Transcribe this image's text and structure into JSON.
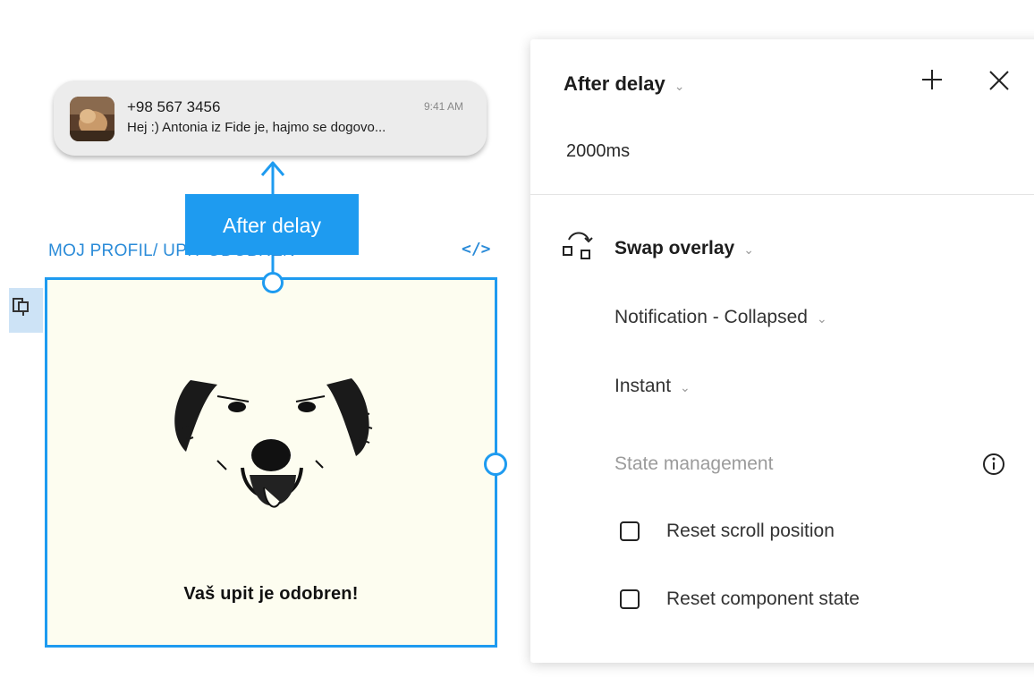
{
  "notification": {
    "phone": "+98 567 3456",
    "time": "9:41 AM",
    "message": "Hej :) Antonia iz Fide je, hajmo se dogovo..."
  },
  "connector": {
    "label": "After delay"
  },
  "frame": {
    "name": "MOJ PROFIL/ UPIT ODOBREN",
    "code_icon": "</>",
    "text": "Vaš upit je odobren!"
  },
  "panel": {
    "trigger": "After delay",
    "delay": "2000ms",
    "action": "Swap overlay",
    "destination": "Notification - Collapsed",
    "animation": "Instant",
    "state_management": "State management",
    "options": [
      {
        "label": "Reset scroll position",
        "checked": false
      },
      {
        "label": "Reset component state",
        "checked": false
      }
    ]
  },
  "colors": {
    "accent": "#1e9bf0",
    "frame_bg": "#fdfdf0",
    "muted": "#9b9b9b"
  },
  "icons": [
    "plus-icon",
    "close-icon",
    "swap-overlay-icon",
    "info-icon",
    "component-icon",
    "code-icon",
    "chevron-down-icon"
  ]
}
